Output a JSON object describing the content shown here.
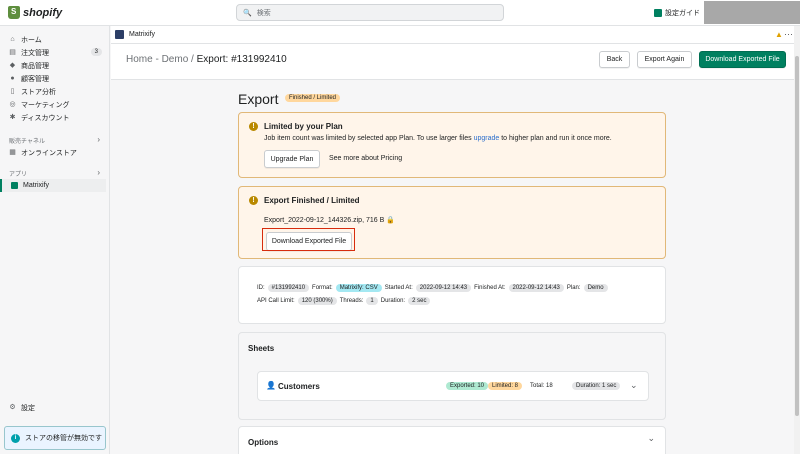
{
  "topbar": {
    "logo": "shopify",
    "search_placeholder": "検索",
    "store_guide": "設定ガイド"
  },
  "sidebar": {
    "items": [
      {
        "label": "ホーム",
        "icon": "home-icon"
      },
      {
        "label": "注文管理",
        "icon": "orders-icon",
        "count": "3"
      },
      {
        "label": "商品管理",
        "icon": "products-icon"
      },
      {
        "label": "顧客管理",
        "icon": "customers-icon"
      },
      {
        "label": "ストア分析",
        "icon": "analytics-icon"
      },
      {
        "label": "マーケティング",
        "icon": "marketing-icon"
      },
      {
        "label": "ディスカウント",
        "icon": "discount-icon"
      }
    ],
    "sales_channels_label": "販売チャネル",
    "online_store": "オンラインストア",
    "apps_label": "アプリ",
    "app_item": "Matrixify",
    "settings": "設定",
    "notice": "ストアの移管が無効です"
  },
  "appbar": {
    "app_name": "Matrixify"
  },
  "header": {
    "crumb_home": "Home",
    "crumb_sep1": " - ",
    "crumb_demo": "Demo",
    "crumb_sep2": " / ",
    "crumb_current": "Export: #131992410",
    "back": "Back",
    "export_again": "Export Again",
    "download": "Download Exported File"
  },
  "page": {
    "title": "Export",
    "status": "Finished / Limited"
  },
  "plan_card": {
    "title": "Limited by your Plan",
    "text_before": "Job item count was limited by selected app Plan. To use larger files ",
    "link": "upgrade",
    "text_after": " to higher plan and run it once more.",
    "upgrade_button": "Upgrade Plan",
    "pricing_link": "See more about Pricing"
  },
  "finished_card": {
    "title": "Export Finished / Limited",
    "file": "Export_2022-09-12_144326.zip, 716 B",
    "download_button": "Download Exported File"
  },
  "meta": {
    "id_label": "ID:",
    "id": "#131992410",
    "format_label": "Format:",
    "format": "Matrixify: CSV",
    "started_label": "Started At:",
    "started": "2022-09-12 14:43",
    "finished_label": "Finished At:",
    "finished": "2022-09-12 14:43",
    "plan_label": "Plan:",
    "plan": "Demo",
    "api_label": "API Call Limit:",
    "api": "120 (300%)",
    "threads_label": "Threads:",
    "threads": "1",
    "duration_label": "Duration:",
    "duration": "2 sec"
  },
  "sheets": {
    "title": "Sheets",
    "customers": "Customers",
    "exported": "Exported: 10",
    "limited": "Limited: 8",
    "total": "Total: 18",
    "duration": "Duration: 1 sec"
  },
  "options": {
    "title": "Options"
  }
}
